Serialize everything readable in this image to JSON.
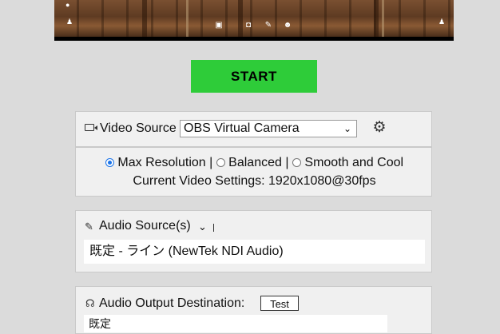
{
  "start_button": {
    "label": "START"
  },
  "video_source": {
    "label": "Video Source",
    "selected": "OBS Virtual Camera",
    "options_text": {
      "max_resolution": "Max Resolution |",
      "balanced": "Balanced |",
      "smooth": "Smooth and Cool"
    },
    "selected_option": "max_resolution",
    "current_settings": "Current Video Settings: 1920x1080@30fps"
  },
  "audio_source": {
    "label": "Audio Source(s)",
    "items": [
      "既定 - ライン (NewTek NDI Audio)"
    ]
  },
  "audio_output": {
    "label": "Audio Output Destination:",
    "test_label": "Test",
    "selected": "既定"
  },
  "icons": {
    "camera": "video-camera-icon",
    "gear": "gear-icon",
    "microphone": "microphone-icon",
    "headphones": "headphones-icon",
    "chevron": "chevron-down-icon"
  },
  "colors": {
    "start": "#2ecc39",
    "radio_accent": "#1a73e8",
    "panel": "#f0f0f0",
    "background": "#dbdbdb"
  }
}
